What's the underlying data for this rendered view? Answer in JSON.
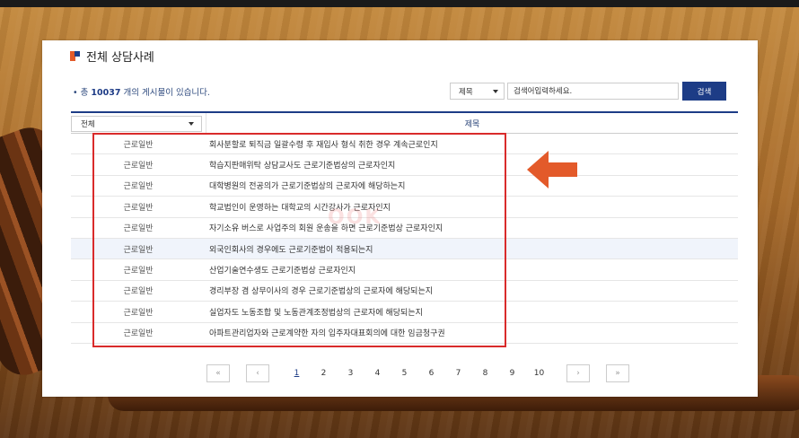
{
  "page": {
    "title": "전체 상담사례"
  },
  "summary": {
    "prefix": "• 총 ",
    "count": "10037",
    "suffix": " 개의 게시물이 있습니다."
  },
  "search": {
    "field_selected": "제목",
    "placeholder": "검색어입력하세요.",
    "button_label": "검색"
  },
  "table": {
    "category_filter": "전체",
    "column_title": "제목",
    "rows": [
      {
        "category": "근로일반",
        "title": "회사분할로 퇴직금 일괄수령 후 재입사 형식 취한 경우 계속근로인지"
      },
      {
        "category": "근로일반",
        "title": "학습지판매위탁 상담교사도 근로기준법상의 근로자인지"
      },
      {
        "category": "근로일반",
        "title": "대학병원의 전공의가 근로기준법상의 근로자에 해당하는지"
      },
      {
        "category": "근로일반",
        "title": "학교법인이 운영하는 대학교의 시간강사가 근로자인지"
      },
      {
        "category": "근로일반",
        "title": "자기소유 버스로 사업주의 회원 운송을 하면 근로기준법상 근로자인지"
      },
      {
        "category": "근로일반",
        "title": "외국인회사의 경우에도 근로기준법이 적용되는지"
      },
      {
        "category": "근로일반",
        "title": "산업기술연수생도 근로기준법상 근로자인지"
      },
      {
        "category": "근로일반",
        "title": "경리부장 겸 상무이사의 경우 근로기준법상의 근로자에 해당되는지"
      },
      {
        "category": "근로일반",
        "title": "실업자도 노동조합 및 노동관계조정법상의 근로자에 해당되는지"
      },
      {
        "category": "근로일반",
        "title": "아파트관리업자와 근로계약한 자의 입주자대표회의에 대한 임금청구권"
      }
    ]
  },
  "pagination": {
    "first": "«",
    "prev": "‹",
    "next": "›",
    "last": "»",
    "pages": [
      "1",
      "2",
      "3",
      "4",
      "5",
      "6",
      "7",
      "8",
      "9",
      "10"
    ],
    "current": "1"
  },
  "watermark": "OOK",
  "colors": {
    "accent": "#1d3c86",
    "highlight_box": "#d92b2b",
    "arrow": "#e35a2a"
  },
  "icons": {
    "arrow": "left-arrow-icon",
    "dropdown": "triangle-down-icon"
  }
}
